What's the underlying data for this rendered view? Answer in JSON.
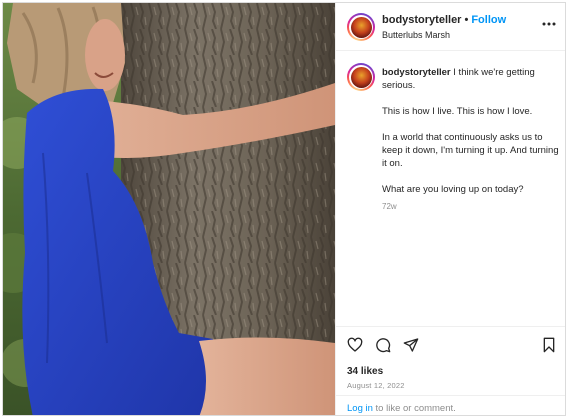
{
  "post": {
    "username": "bodystoryteller",
    "separator": "•",
    "follow_label": "Follow",
    "location": "Butterlubs Marsh"
  },
  "caption": {
    "username": "bodystoryteller",
    "first_line": " I think we're getting serious.",
    "paragraph_2": "This is how I live. This is how I love.",
    "paragraph_3": "In a world that continuously asks us to keep it down, I'm turning it up. And turning it on.",
    "paragraph_4": "What are you loving up on today?",
    "time_ago": "72w"
  },
  "engagement": {
    "likes": "34 likes",
    "date": "August 12, 2022"
  },
  "login": {
    "link": "Log in",
    "rest": " to like or comment."
  },
  "icons": {
    "more": "more-options-icon",
    "like": "heart-icon",
    "comment": "comment-icon",
    "share": "share-icon",
    "save": "bookmark-icon"
  },
  "colors": {
    "link": "#0095f6",
    "text": "#262626",
    "muted": "#8e8e8e",
    "dress": "#2a44c8"
  }
}
